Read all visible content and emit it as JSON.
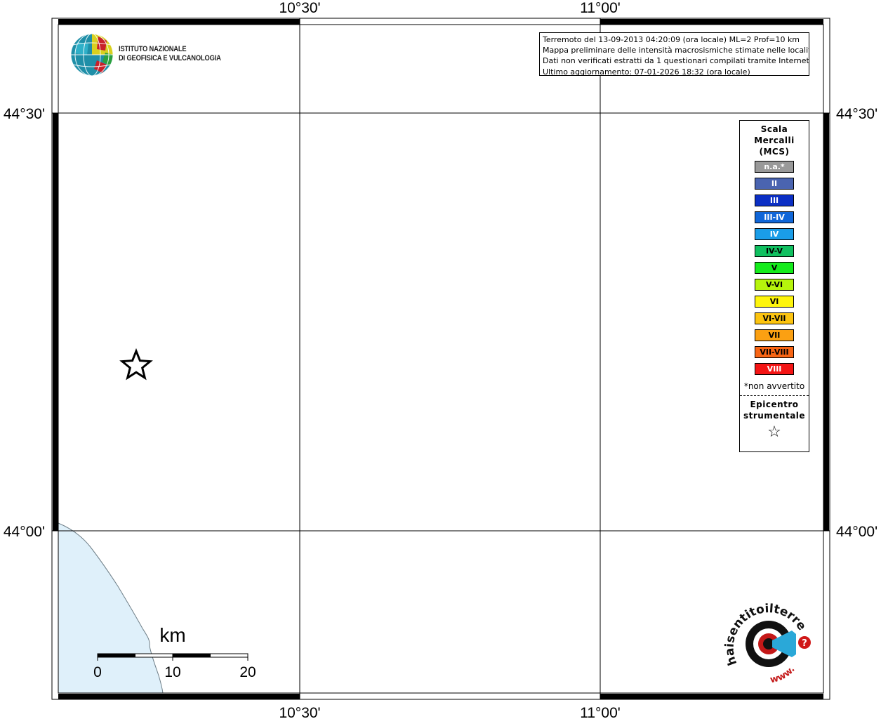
{
  "map": {
    "top_labels": [
      "10°30'",
      "11°00'"
    ],
    "bottom_labels": [
      "10°30'",
      "11°00'"
    ],
    "left_labels": [
      "44°30'",
      "44°00'"
    ],
    "right_labels": [
      "44°30'",
      "44°00'"
    ],
    "sea_color": "#dff0fa",
    "coast_color": "#6f7f88"
  },
  "logo": {
    "line1": "ISTITUTO NAZIONALE",
    "line2": "DI GEOFISICA E VULCANOLOGIA"
  },
  "info": {
    "line1": "Terremoto del 13-09-2013 04:20:09 (ora locale) ML=2 Prof=10 km",
    "line2": "Mappa preliminare delle intensità macrosismiche stimate nelle località",
    "line3": "Dati non verificati estratti da 1 questionari compilati tramite Internet.",
    "line4": "Ultimo aggiornamento: 07-01-2026 18:32 (ora locale)"
  },
  "legend": {
    "title1": "Scala",
    "title2": "Mercalli",
    "title3": "(MCS)",
    "items": [
      {
        "label": "n.a.*",
        "color": "#999999"
      },
      {
        "label": "II",
        "color": "#4a64b0"
      },
      {
        "label": "III",
        "color": "#0b2fc4"
      },
      {
        "label": "III-IV",
        "color": "#1066d8"
      },
      {
        "label": "IV",
        "color": "#1a9de8"
      },
      {
        "label": "IV-V",
        "color": "#10c060"
      },
      {
        "label": "V",
        "color": "#14ec1c"
      },
      {
        "label": "V-VI",
        "color": "#b6f40c"
      },
      {
        "label": "VI",
        "color": "#fef50c"
      },
      {
        "label": "VI-VII",
        "color": "#fcc410"
      },
      {
        "label": "VII",
        "color": "#fba012"
      },
      {
        "label": "VII-VIII",
        "color": "#f86514"
      },
      {
        "label": "VIII",
        "color": "#f41414"
      }
    ],
    "note": "*non avvertito",
    "epi1": "Epicentro",
    "epi2": "strumentale",
    "epi_symbol": "☆"
  },
  "scalebar": {
    "unit": "km",
    "ticks": [
      "0",
      "10",
      "20"
    ]
  },
  "brand": {
    "left_text": "haisentitoilterremoto.it",
    "bottom_text": "www.",
    "question": "?"
  }
}
